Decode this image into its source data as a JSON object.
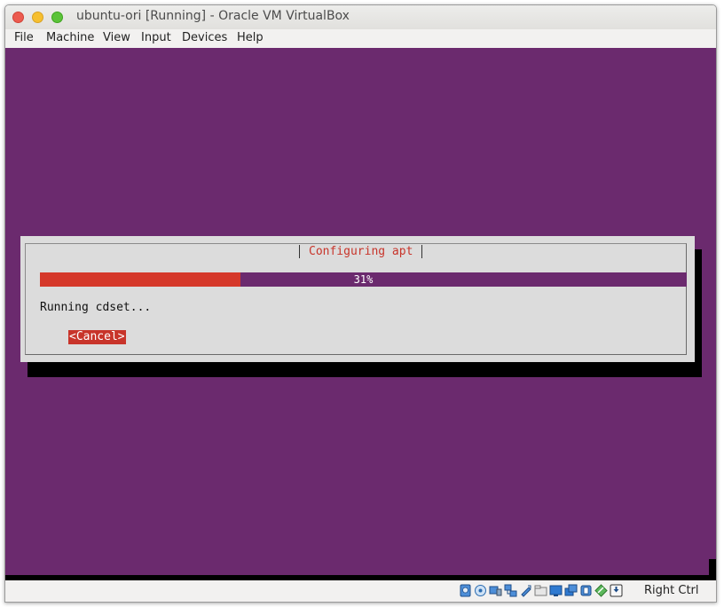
{
  "window": {
    "title": "ubuntu-ori [Running] - Oracle VM VirtualBox"
  },
  "menu": {
    "items": [
      "File",
      "Machine",
      "View",
      "Input",
      "Devices",
      "Help"
    ]
  },
  "installer": {
    "dialog_title": "Configuring apt",
    "progress_percent": 31,
    "progress_label": "31%",
    "status_text": "Running cdset...",
    "cancel_label": "<Cancel>"
  },
  "statusbar": {
    "icons": [
      "hard-disk-icon",
      "optical-drive-icon",
      "audio-icon",
      "network-icon",
      "usb-icon",
      "shared-folders-icon",
      "display-icon",
      "video-capture-icon",
      "cpu-icon",
      "mouse-integration-icon",
      "keyboard-icon"
    ],
    "host_key": "Right Ctrl"
  },
  "colors": {
    "screen_bg": "#6b2a6e",
    "accent_red": "#d5382a",
    "dialog_bg": "#dcdcdc"
  }
}
